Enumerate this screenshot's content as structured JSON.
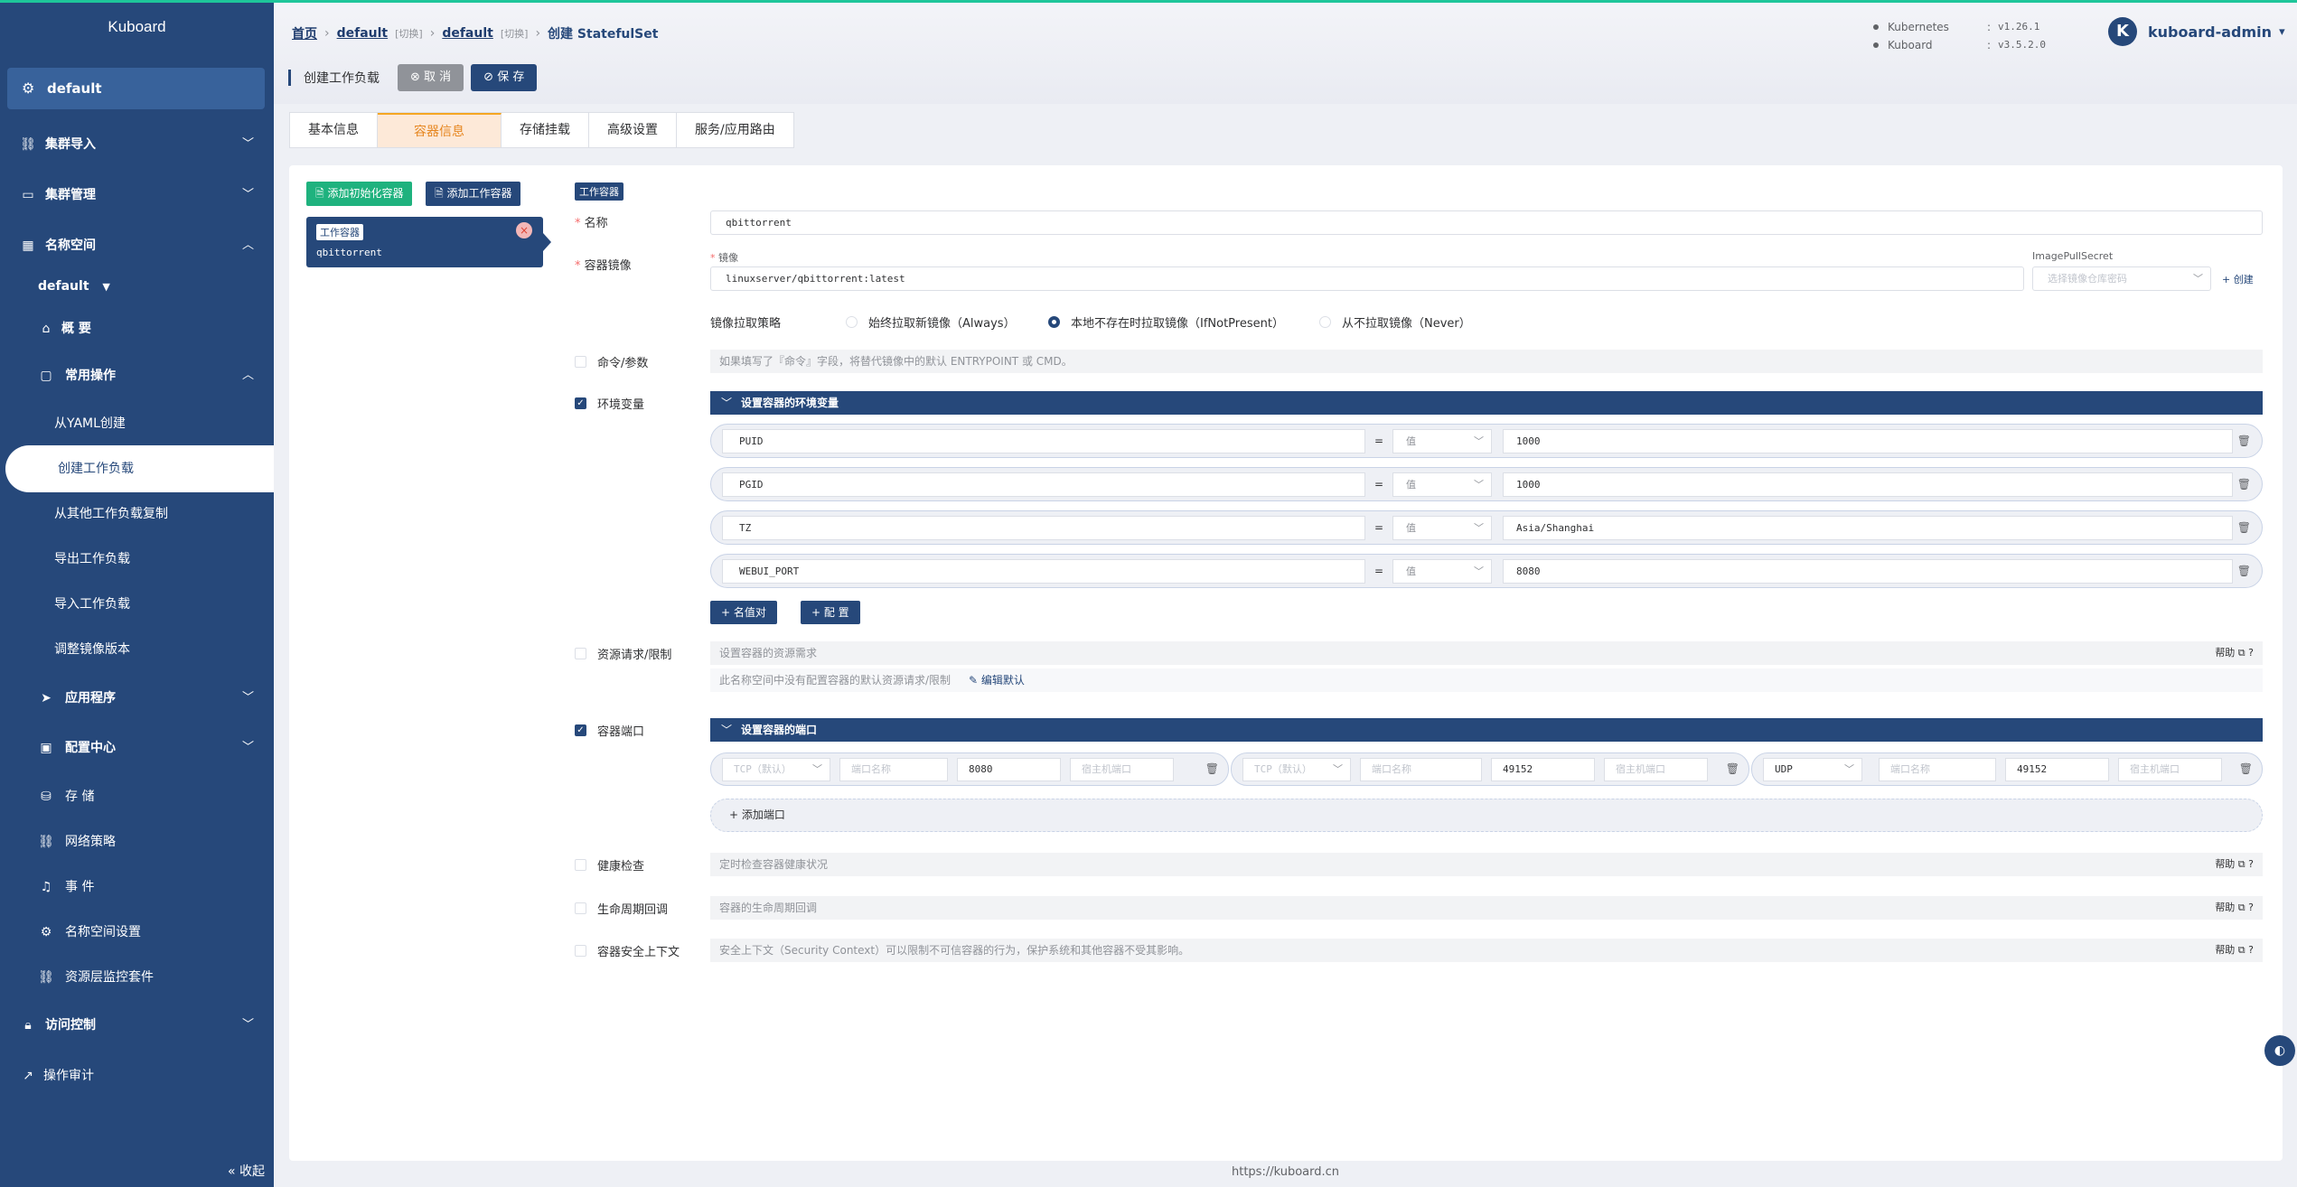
{
  "app": {
    "logo": "Kuboard"
  },
  "sidebar": {
    "namespace": "default",
    "items": {
      "cluster_import": "集群导入",
      "cluster_manage": "集群管理",
      "namespace": "名称空间",
      "ns_default": "default",
      "overview": "概 要",
      "common_ops": "常用操作",
      "from_yaml": "从YAML创建",
      "create_workload": "创建工作负载",
      "copy_workload": "从其他工作负载复制",
      "export_workload": "导出工作负载",
      "import_workload": "导入工作负载",
      "adjust_image": "调整镜像版本",
      "apps": "应用程序",
      "config": "配置中心",
      "storage": "存 储",
      "netpolicy": "网络策略",
      "events": "事 件",
      "ns_settings": "名称空间设置",
      "monitor": "资源层监控套件",
      "access": "访问控制",
      "audit": "操作审计"
    },
    "collapse": "« 收起"
  },
  "header": {
    "crumbs": {
      "home": "首页",
      "ns1": "default",
      "switch": "[切换]",
      "ns2": "default",
      "current": "创建 StatefulSet"
    },
    "versions": {
      "k8s_label": "Kubernetes",
      "k8s_sep": ":",
      "k8s_ver": "v1.26.1",
      "kb_label": "Kuboard",
      "kb_sep": ":",
      "kb_ver": "v3.5.2.0"
    },
    "user": {
      "avatar": "K",
      "name": "kuboard-admin",
      "caret": "▾"
    },
    "page_label": "创建工作负载",
    "cancel": "⊗ 取 消",
    "save": "⊘ 保 存"
  },
  "tabs": [
    "基本信息",
    "容器信息",
    "存储挂载",
    "高级设置",
    "服务/应用路由"
  ],
  "main": {
    "add_init": "添加初始化容器",
    "add_work": "添加工作容器",
    "card_tag": "工作容器",
    "card_name": "qbittorrent",
    "work_tag": "工作容器",
    "name_label": "名称",
    "name_value": "qbittorrent",
    "image_label": "容器镜像",
    "image_sub": "镜像",
    "image_value": "linuxserver/qbittorrent:latest",
    "pull_secret_label": "ImagePullSecret",
    "pull_secret_ph": "选择镜像仓库密码",
    "create": "+ 创建",
    "pull_policy_label": "镜像拉取策略",
    "pull_always": "始终拉取新镜像（Always）",
    "pull_ifnot": "本地不存在时拉取镜像（IfNotPresent）",
    "pull_never": "从不拉取镜像（Never）",
    "cmd_label": "命令/参数",
    "cmd_hint": "如果填写了『命令』字段，将替代镜像中的默认 ENTRYPOINT 或 CMD。",
    "env_label": "环境变量",
    "env_header": "设置容器的环境变量",
    "env_rows": [
      {
        "key": "PUID",
        "op": "=",
        "type": "值",
        "value": "1000"
      },
      {
        "key": "PGID",
        "op": "=",
        "type": "值",
        "value": "1000"
      },
      {
        "key": "TZ",
        "op": "=",
        "type": "值",
        "value": "Asia/Shanghai"
      },
      {
        "key": "WEBUI_PORT",
        "op": "=",
        "type": "值",
        "value": "8080"
      }
    ],
    "add_kv": "+ 名值对",
    "add_cfg": "+ 配 置",
    "res_label": "资源请求/限制",
    "res_hint": "设置容器的资源需求",
    "res_note": "此名称空间中没有配置容器的默认资源请求/限制",
    "edit_default": "编辑默认",
    "help": "帮助",
    "port_label": "容器端口",
    "port_header": "设置容器的端口",
    "ports": [
      {
        "protocol": "TCP（默认）",
        "name_ph": "端口名称",
        "port": "8080",
        "host_ph": "宿主机端口"
      },
      {
        "protocol": "TCP（默认）",
        "name_ph": "端口名称",
        "port": "49152",
        "host_ph": "宿主机端口"
      },
      {
        "protocol": "UDP",
        "name_ph": "端口名称",
        "port": "49152",
        "host_ph": "宿主机端口"
      }
    ],
    "add_port": "+ 添加端口",
    "health_label": "健康检查",
    "health_hint": "定时检查容器健康状况",
    "lifecycle_label": "生命周期回调",
    "lifecycle_hint": "容器的生命周期回调",
    "security_label": "容器安全上下文",
    "security_hint": "安全上下文（Security Context）可以限制不可信容器的行为，保护系统和其他容器不受其影响。"
  },
  "footer": "https://kuboard.cn"
}
